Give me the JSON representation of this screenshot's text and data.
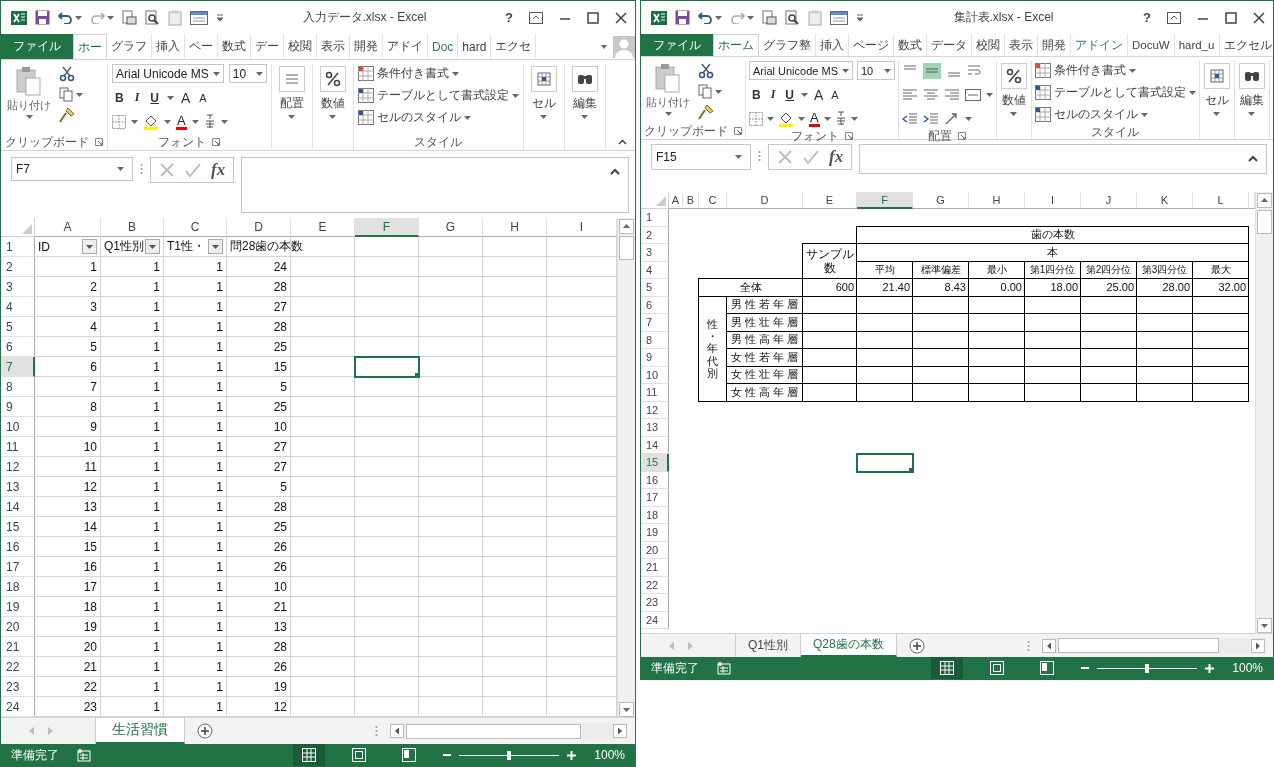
{
  "windows": [
    {
      "title": "入力データ.xlsx - Excel",
      "help": "?",
      "ribbon_tabs": [
        {
          "label": "ファイル",
          "kind": "file",
          "selected": false
        },
        {
          "label": "ホー",
          "kind": "tab",
          "selected": true
        },
        {
          "label": "グラフ",
          "kind": "tab",
          "selected": false
        },
        {
          "label": "挿入",
          "kind": "tab",
          "selected": false
        },
        {
          "label": "ペー",
          "kind": "tab",
          "selected": false
        },
        {
          "label": "数式",
          "kind": "tab",
          "selected": false
        },
        {
          "label": "デー",
          "kind": "tab",
          "selected": false
        },
        {
          "label": "校閲",
          "kind": "tab",
          "selected": false
        },
        {
          "label": "表示",
          "kind": "tab",
          "selected": false
        },
        {
          "label": "開発",
          "kind": "tab",
          "selected": false
        },
        {
          "label": "アドイ",
          "kind": "tab",
          "selected": false
        },
        {
          "label": "Doc",
          "kind": "addin",
          "selected": false
        },
        {
          "label": "hard",
          "kind": "tab",
          "selected": false
        },
        {
          "label": "エクセ",
          "kind": "tab",
          "selected": false
        }
      ],
      "ribbon": [
        {
          "kind": "clipboard",
          "label": "クリップボード",
          "launcher": true,
          "paste": "貼り付け"
        },
        {
          "kind": "font",
          "label": "フォント",
          "launcher": true,
          "font": "Arial Unicode MS",
          "size": "10",
          "style_buttons": [
            "B",
            "I",
            "U"
          ],
          "size_buttons": [
            "A",
            "A"
          ],
          "color_button": "A"
        },
        {
          "kind": "alignment-button",
          "text": "配置"
        },
        {
          "kind": "number-button",
          "text": "数値"
        },
        {
          "kind": "styles",
          "label": "スタイル",
          "launcher": false,
          "items": [
            "条件付き書式",
            "テーブルとして書式設定",
            "セルのスタイル"
          ]
        },
        {
          "kind": "cells-button",
          "text": "セル"
        },
        {
          "kind": "editing-button",
          "text": "編集"
        }
      ],
      "name_box": "F7",
      "function_label": "fx",
      "sheet": {
        "kind": "list",
        "columns": [
          {
            "label": "A",
            "selected": false
          },
          {
            "label": "B",
            "selected": false
          },
          {
            "label": "C",
            "selected": false
          },
          {
            "label": "D",
            "selected": false
          },
          {
            "label": "E",
            "selected": false
          },
          {
            "label": "F",
            "selected": true
          },
          {
            "label": "G",
            "selected": false
          },
          {
            "label": "H",
            "selected": false
          },
          {
            "label": "I",
            "selected": false
          }
        ],
        "row_numbers": [
          {
            "label": "1",
            "selected": false
          },
          {
            "label": "2",
            "selected": false
          },
          {
            "label": "3",
            "selected": false
          },
          {
            "label": "4",
            "selected": false
          },
          {
            "label": "5",
            "selected": false
          },
          {
            "label": "6",
            "selected": false
          },
          {
            "label": "7",
            "selected": true
          },
          {
            "label": "8",
            "selected": false
          },
          {
            "label": "9",
            "selected": false
          },
          {
            "label": "10",
            "selected": false
          },
          {
            "label": "11",
            "selected": false
          },
          {
            "label": "12",
            "selected": false
          },
          {
            "label": "13",
            "selected": false
          },
          {
            "label": "14",
            "selected": false
          },
          {
            "label": "15",
            "selected": false
          },
          {
            "label": "16",
            "selected": false
          },
          {
            "label": "17",
            "selected": false
          },
          {
            "label": "18",
            "selected": false
          },
          {
            "label": "19",
            "selected": false
          },
          {
            "label": "20",
            "selected": false
          },
          {
            "label": "21",
            "selected": false
          },
          {
            "label": "22",
            "selected": false
          },
          {
            "label": "23",
            "selected": false
          },
          {
            "label": "24",
            "selected": false
          }
        ],
        "header": [
          {
            "text": "ID",
            "filter": true
          },
          {
            "text": "Q1性別",
            "filter": true
          },
          {
            "text": "T1性・",
            "filter": true
          },
          {
            "text": "問28歯の本数",
            "filter": false
          }
        ],
        "rows": [
          [
            "1",
            "1",
            "1",
            "24"
          ],
          [
            "2",
            "1",
            "1",
            "28"
          ],
          [
            "3",
            "1",
            "1",
            "27"
          ],
          [
            "4",
            "1",
            "1",
            "28"
          ],
          [
            "5",
            "1",
            "1",
            "25"
          ],
          [
            "6",
            "1",
            "1",
            "15"
          ],
          [
            "7",
            "1",
            "1",
            "5"
          ],
          [
            "8",
            "1",
            "1",
            "25"
          ],
          [
            "9",
            "1",
            "1",
            "10"
          ],
          [
            "10",
            "1",
            "1",
            "27"
          ],
          [
            "11",
            "1",
            "1",
            "27"
          ],
          [
            "12",
            "1",
            "1",
            "5"
          ],
          [
            "13",
            "1",
            "1",
            "28"
          ],
          [
            "14",
            "1",
            "1",
            "25"
          ],
          [
            "15",
            "1",
            "1",
            "26"
          ],
          [
            "16",
            "1",
            "1",
            "26"
          ],
          [
            "17",
            "1",
            "1",
            "10"
          ],
          [
            "18",
            "1",
            "1",
            "21"
          ],
          [
            "19",
            "1",
            "1",
            "13"
          ],
          [
            "20",
            "1",
            "1",
            "28"
          ],
          [
            "21",
            "1",
            "1",
            "26"
          ],
          [
            "22",
            "1",
            "1",
            "19"
          ],
          [
            "23",
            "1",
            "1",
            "12"
          ]
        ]
      },
      "sheet_tabs": [
        {
          "label": "生活習慣",
          "selected": true
        }
      ],
      "status": "準備完了",
      "views": [
        {
          "kind": "normal",
          "selected": true
        },
        {
          "kind": "page-layout",
          "selected": false
        },
        {
          "kind": "page-break",
          "selected": false
        }
      ],
      "zoom": {
        "level": 0.5,
        "label": "100%"
      }
    },
    {
      "title": "集計表.xlsx - Excel",
      "help": "?",
      "ribbon_tabs": [
        {
          "label": "ファイル",
          "kind": "file",
          "selected": false
        },
        {
          "label": "ホーム",
          "kind": "tab",
          "selected": true
        },
        {
          "label": "グラフ整",
          "kind": "tab",
          "selected": false
        },
        {
          "label": "挿入",
          "kind": "tab",
          "selected": false
        },
        {
          "label": "ページ",
          "kind": "tab",
          "selected": false
        },
        {
          "label": "数式",
          "kind": "tab",
          "selected": false
        },
        {
          "label": "データ",
          "kind": "tab",
          "selected": false
        },
        {
          "label": "校閲",
          "kind": "tab",
          "selected": false
        },
        {
          "label": "表示",
          "kind": "tab",
          "selected": false
        },
        {
          "label": "開発",
          "kind": "tab",
          "selected": false
        },
        {
          "label": "アドイン",
          "kind": "addin",
          "selected": false
        },
        {
          "label": "DocuW",
          "kind": "tab",
          "selected": false
        },
        {
          "label": "hard_u",
          "kind": "tab",
          "selected": false
        },
        {
          "label": "エクセル",
          "kind": "tab",
          "selected": false
        }
      ],
      "ribbon": [
        {
          "kind": "clipboard",
          "label": "クリップボード",
          "launcher": true,
          "paste": "貼り付け"
        },
        {
          "kind": "font",
          "label": "フォント",
          "launcher": true,
          "font": "Arial Unicode MS",
          "size": "10",
          "style_buttons": [
            "B",
            "I",
            "U"
          ],
          "size_buttons": [
            "A",
            "A"
          ],
          "color_button": "A"
        },
        {
          "kind": "alignment",
          "label": "配置",
          "launcher": true
        },
        {
          "kind": "number-button",
          "text": "数値"
        },
        {
          "kind": "styles",
          "label": "スタイル",
          "launcher": false,
          "items": [
            "条件付き書式",
            "テーブルとして書式設定",
            "セルのスタイル"
          ]
        },
        {
          "kind": "cells-button",
          "text": "セル"
        },
        {
          "kind": "editing-button",
          "text": "編集"
        }
      ],
      "name_box": "F15",
      "function_label": "fx",
      "sheet": {
        "kind": "report",
        "columns": [
          {
            "label": "A",
            "selected": false
          },
          {
            "label": "B",
            "selected": false
          },
          {
            "label": "C",
            "selected": false
          },
          {
            "label": "D",
            "selected": false
          },
          {
            "label": "E",
            "selected": false
          },
          {
            "label": "F",
            "selected": true
          },
          {
            "label": "G",
            "selected": false
          },
          {
            "label": "H",
            "selected": false
          },
          {
            "label": "I",
            "selected": false
          },
          {
            "label": "J",
            "selected": false
          },
          {
            "label": "K",
            "selected": false
          },
          {
            "label": "L",
            "selected": false
          }
        ],
        "row_numbers": [
          {
            "label": "1",
            "selected": false
          },
          {
            "label": "2",
            "selected": false
          },
          {
            "label": "3",
            "selected": false
          },
          {
            "label": "4",
            "selected": false
          },
          {
            "label": "5",
            "selected": false
          },
          {
            "label": "6",
            "selected": false
          },
          {
            "label": "7",
            "selected": false
          },
          {
            "label": "8",
            "selected": false
          },
          {
            "label": "9",
            "selected": false
          },
          {
            "label": "10",
            "selected": false
          },
          {
            "label": "11",
            "selected": false
          },
          {
            "label": "12",
            "selected": false
          },
          {
            "label": "13",
            "selected": false
          },
          {
            "label": "14",
            "selected": false
          },
          {
            "label": "15",
            "selected": true
          },
          {
            "label": "16",
            "selected": false
          },
          {
            "label": "17",
            "selected": false
          },
          {
            "label": "18",
            "selected": false
          },
          {
            "label": "19",
            "selected": false
          },
          {
            "label": "20",
            "selected": false
          },
          {
            "label": "21",
            "selected": false
          },
          {
            "label": "22",
            "selected": false
          },
          {
            "label": "23",
            "selected": false
          },
          {
            "label": "24",
            "selected": false
          }
        ],
        "report": {
          "title": "歯の本数",
          "unit": "本",
          "sample_label": "サンプル数",
          "stats": [
            "平均",
            "標準偏差",
            "最小",
            "第1四分位",
            "第2四分位",
            "第3四分位",
            "最大"
          ],
          "total": {
            "label": "全体",
            "sample": "600",
            "values": [
              "21.40",
              "8.43",
              "0.00",
              "18.00",
              "25.00",
              "28.00",
              "32.00"
            ]
          },
          "breakdown": {
            "label": "性・年代別",
            "rows": [
              "男性若年層",
              "男性壮年層",
              "男性高年層",
              "女性若年層",
              "女性壮年層",
              "女性高年層"
            ]
          }
        }
      },
      "sheet_tabs": [
        {
          "label": "Q1性別",
          "selected": false
        },
        {
          "label": "Q28歯の本数",
          "selected": true
        }
      ],
      "status": "準備完了",
      "views": [
        {
          "kind": "normal",
          "selected": true
        },
        {
          "kind": "page-layout",
          "selected": false
        },
        {
          "kind": "page-break",
          "selected": false
        }
      ],
      "zoom": {
        "level": 0.5,
        "label": "100%"
      }
    }
  ]
}
